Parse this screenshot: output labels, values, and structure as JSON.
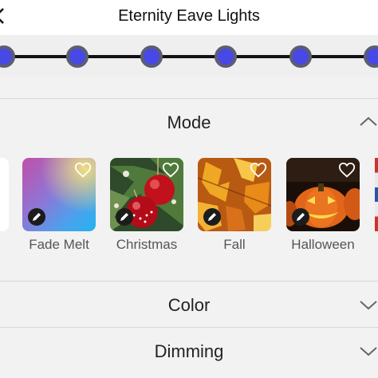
{
  "header": {
    "title": "Eternity Eave Lights",
    "back_icon": "chevron-left-icon"
  },
  "bulbs": {
    "count_visible": 6,
    "color": "#4848e6"
  },
  "sections": {
    "mode": {
      "label": "Mode",
      "expanded": true,
      "icon": "chevron-up-icon"
    },
    "color": {
      "label": "Color",
      "expanded": false,
      "icon": "chevron-down-icon"
    },
    "dimming": {
      "label": "Dimming",
      "expanded": false,
      "icon": "chevron-down-icon"
    }
  },
  "modes": [
    {
      "name": "Fade Melt",
      "favorite": false
    },
    {
      "name": "Christmas",
      "favorite": false
    },
    {
      "name": "Fall",
      "favorite": false
    },
    {
      "name": "Halloween",
      "favorite": false
    }
  ],
  "icons": {
    "favorite": "heart-outline-icon",
    "edit": "pencil-icon"
  }
}
